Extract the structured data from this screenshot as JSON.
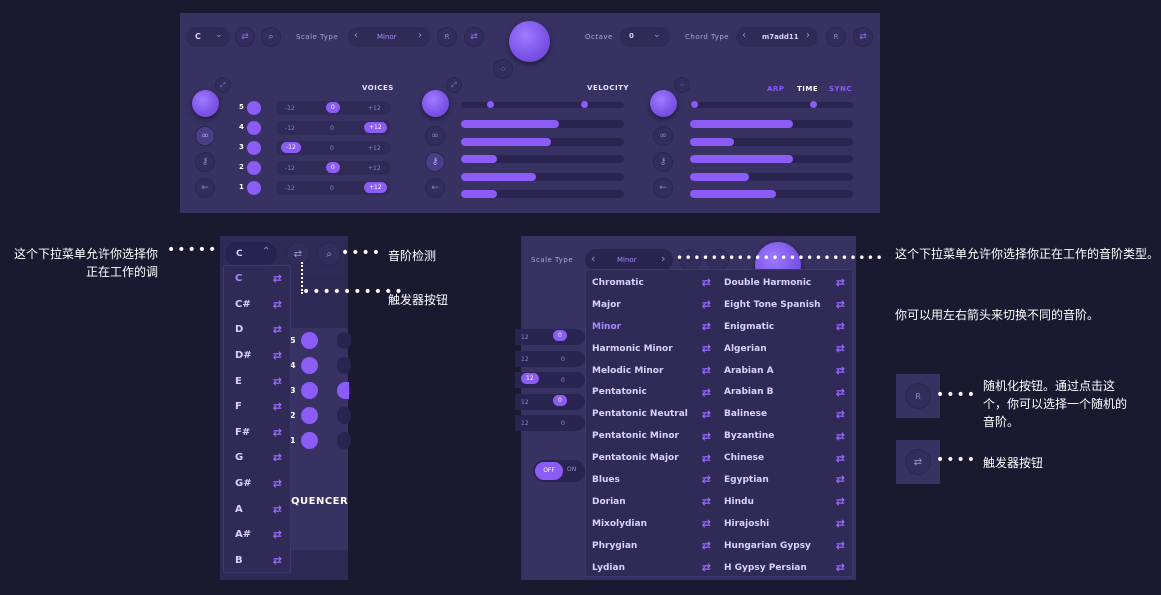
{
  "top_panel": {
    "key_value": "C",
    "scale_type_label": "Scale Type",
    "scale_value": "Minor",
    "random_label": "R",
    "octave_label": "Octave",
    "octave_value": "0",
    "chord_type_label": "Chord Type",
    "chord_value": "m7add11",
    "voices_title": "VOICES",
    "velocity_title": "VELOCITY",
    "tabs": [
      "ARP",
      "TIME",
      "SYNC"
    ],
    "voices": [
      {
        "num": "5",
        "left": "-12",
        "mid": "0",
        "right": "+12"
      },
      {
        "num": "4",
        "left": "-12",
        "mid": "0",
        "right": "+12"
      },
      {
        "num": "3",
        "left": "-12",
        "mid": "0",
        "right": "+12"
      },
      {
        "num": "2",
        "left": "-12",
        "mid": "0",
        "right": "+12"
      },
      {
        "num": "1",
        "left": "-12",
        "mid": "0",
        "right": "+12"
      }
    ],
    "velocity_levels": [
      0.6,
      0.55,
      0.22,
      0.46,
      0.22
    ],
    "time_levels": [
      0.63,
      0.27,
      0.63,
      0.36,
      0.53
    ]
  },
  "key_panel": {
    "key_value": "C",
    "notes": [
      "C",
      "C#",
      "D",
      "D#",
      "E",
      "F",
      "F#",
      "G",
      "G#",
      "A",
      "A#",
      "B"
    ],
    "voice_nums": [
      "5",
      "4",
      "3",
      "2",
      "1"
    ],
    "sequencer_label": "QUENCER"
  },
  "scale_panel": {
    "scale_type_label": "Scale Type",
    "scale_value": "Minor",
    "toggle_off": "OFF",
    "toggle_on": "ON",
    "left_values": [
      "12",
      "12",
      "12",
      "12",
      "12"
    ],
    "mid_values": [
      "0",
      "0",
      "0",
      "0",
      "0"
    ],
    "scales_col1": [
      "Chromatic",
      "Major",
      "Minor",
      "Harmonic Minor",
      "Melodic Minor",
      "Pentatonic",
      "Pentatonic Neutral",
      "Pentatonic Minor",
      "Pentatonic Major",
      "Blues",
      "Dorian",
      "Mixolydian",
      "Phrygian",
      "Lydian"
    ],
    "scales_col2": [
      "Double Harmonic",
      "Eight Tone Spanish",
      "Enigmatic",
      "Algerian",
      "Arabian A",
      "Arabian B",
      "Balinese",
      "Byzantine",
      "Chinese",
      "Egyptian",
      "Hindu",
      "Hirajoshi",
      "Hungarian Gypsy",
      "H Gypsy Persian"
    ]
  },
  "annotations": {
    "key_dropdown": "这个下拉菜单允许你选择你正在工作的调",
    "scale_detect": "音阶检测",
    "trigger_btn": "触发器按钮",
    "scale_dropdown": "这个下拉菜单允许你选择你正在工作的音阶类型。",
    "arrows": "你可以用左右箭头来切换不同的音阶。",
    "random_btn": "随机化按钮。通过点击这个，你可以选择一个随机的音阶。",
    "trigger_btn2": "触发器按钮"
  },
  "icons": {
    "random_small": "R",
    "accent": "#8b5cf6",
    "panel": "#383263"
  }
}
